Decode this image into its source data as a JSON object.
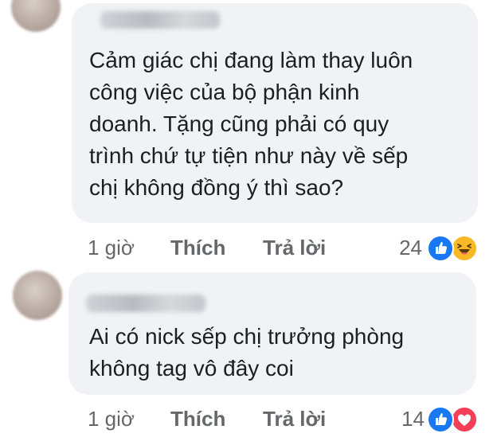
{
  "comments": [
    {
      "author": "",
      "text": "Cảm giác chị đang làm thay luôn\ncông việc của bộ phận kinh\ndoanh. Tặng cũng phải có quy\ntrình chứ tự tiện như này về sếp\nchị không đồng ý thì sao?",
      "time": "1 giờ",
      "like_label": "Thích",
      "reply_label": "Trả lời",
      "reaction_count": "24",
      "reactions": [
        "like-icon",
        "haha-icon"
      ]
    },
    {
      "author": "",
      "text": "Ai có nick sếp chị trưởng phòng\nkhông tag vô đây coi",
      "time": "1 giờ",
      "like_label": "Thích",
      "reply_label": "Trả lời",
      "reaction_count": "14",
      "reactions": [
        "like-icon",
        "love-icon"
      ]
    }
  ],
  "colors": {
    "bubble": "#f0f2f5",
    "meta_text": "#65676b",
    "like": "#1877f2",
    "haha": "#f7b928",
    "love": "#f33e58"
  }
}
